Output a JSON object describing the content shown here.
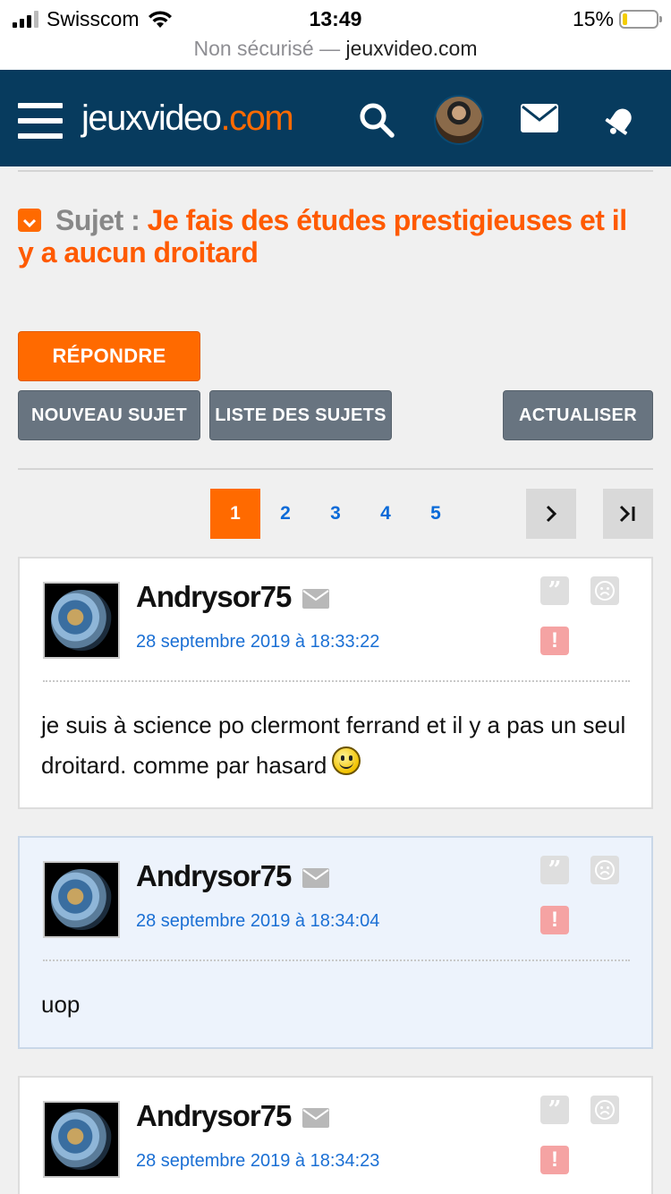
{
  "status_bar": {
    "carrier": "Swisscom",
    "time": "13:49",
    "battery": "15%"
  },
  "url_bar": {
    "security": "Non sécurisé —",
    "domain": "jeuxvideo.com"
  },
  "header": {
    "logo_main": "jeuxvideo",
    "logo_suffix": ".com",
    "accent_color": "#ff6a00",
    "bg_color": "#073b5e"
  },
  "topic": {
    "label": "Sujet :",
    "title": "Je fais des études prestigieuses et il y a aucun droitard"
  },
  "actions": {
    "reply": "RÉPONDRE",
    "new_topic": "NOUVEAU SUJET",
    "topic_list": "LISTE DES SUJETS",
    "refresh": "ACTUALISER"
  },
  "pagination": {
    "pages": [
      "1",
      "2",
      "3",
      "4",
      "5"
    ],
    "current": "1",
    "next": "›",
    "last": "›|"
  },
  "posts": [
    {
      "author": "Andrysor75",
      "date": "28 septembre 2019 à 18:33:22",
      "message": "je suis à science po clermont ferrand et il y a pas un seul droitard. comme par hasard",
      "smiley": true
    },
    {
      "author": "Andrysor75",
      "date": "28 septembre 2019 à 18:34:04",
      "message": "uop"
    },
    {
      "author": "Andrysor75",
      "date": "28 septembre 2019 à 18:34:23",
      "message": ""
    }
  ],
  "post_icons": {
    "quote": "”",
    "report": "!"
  }
}
